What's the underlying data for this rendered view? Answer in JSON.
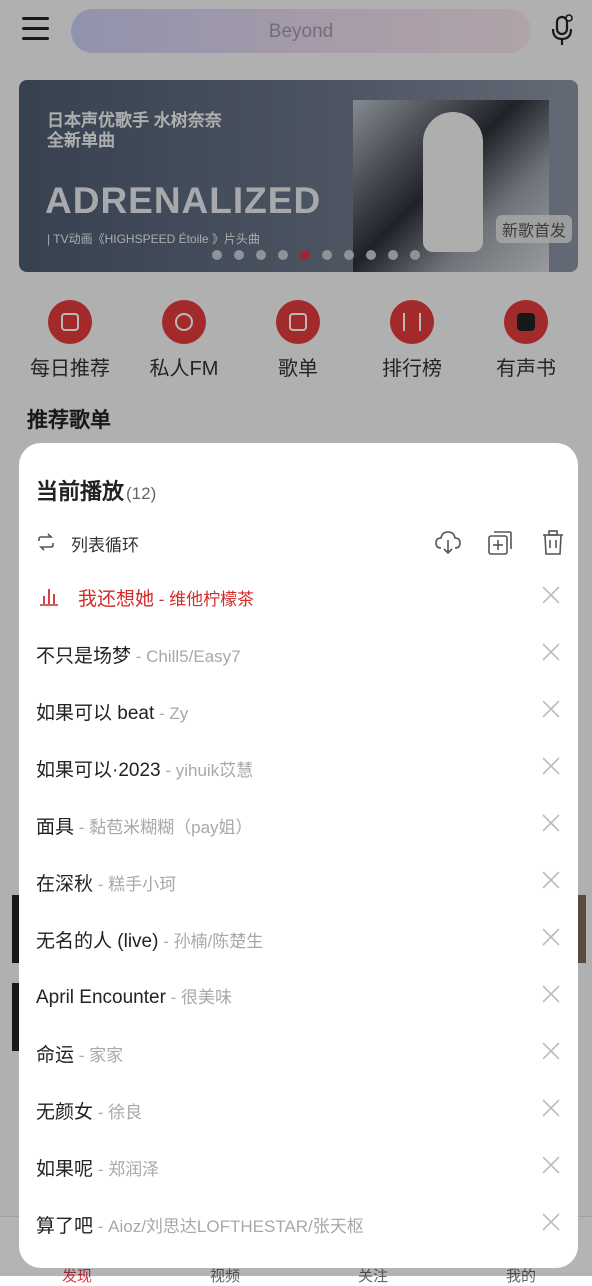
{
  "search": {
    "placeholder": "Beyond"
  },
  "banner": {
    "line1": "日本声优歌手 水树奈奈",
    "line2": "全新单曲",
    "headline": "ADRENALIZED",
    "sub": "| TV动画《HIGHSPEED Étoile 》片头曲",
    "badge": "新歌首发",
    "active_dot_index": 4,
    "dot_count": 10
  },
  "shortcuts": [
    "每日推荐",
    "私人FM",
    "歌单",
    "排行榜",
    "有声书"
  ],
  "section_title": "推荐歌单",
  "tabs": [
    "发现",
    "视频",
    "关注",
    "我的"
  ],
  "colors": {
    "accent": "#e0334a",
    "playing": "#d42a2a"
  },
  "sheet": {
    "title": "当前播放",
    "count": "(12)",
    "mode_label": "列表循环",
    "actions": [
      "download-icon",
      "add-to-playlist-icon",
      "delete-all-icon"
    ],
    "songs": [
      {
        "title": "我还想她",
        "sep": " - ",
        "artist": "维他柠檬茶",
        "playing": true
      },
      {
        "title": "不只是场梦",
        "sep": " - ",
        "artist": "Chill5/Easy7"
      },
      {
        "title": "如果可以 beat",
        "sep": " - ",
        "artist": "Zy"
      },
      {
        "title": "如果可以·2023",
        "sep": " - ",
        "artist": "yihuik苡慧"
      },
      {
        "title": "面具",
        "sep": " - ",
        "artist": "黏苞米糊糊（pay姐）"
      },
      {
        "title": "在深秋",
        "sep": " - ",
        "artist": "糕手小珂"
      },
      {
        "title": "无名的人 (live)",
        "sep": " - ",
        "artist": "孙楠/陈楚生"
      },
      {
        "title": "April Encounter",
        "sep": " - ",
        "artist": "很美味"
      },
      {
        "title": "命运",
        "sep": " - ",
        "artist": "家家"
      },
      {
        "title": "无颜女",
        "sep": " - ",
        "artist": "徐良"
      },
      {
        "title": "如果呢",
        "sep": " - ",
        "artist": "郑润泽"
      },
      {
        "title": "算了吧",
        "sep": " - ",
        "artist": "Aioz/刘思达LOFTHESTAR/张天枢"
      }
    ]
  }
}
